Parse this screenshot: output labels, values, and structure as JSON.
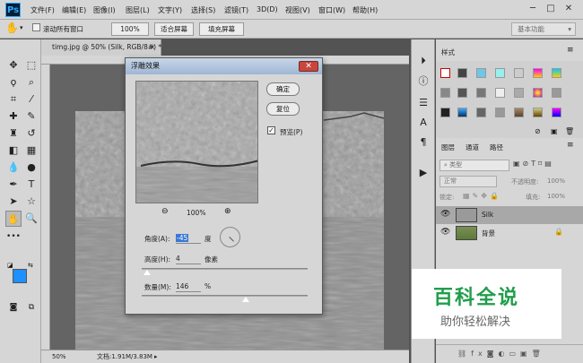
{
  "app": {
    "logo": "Ps"
  },
  "menu": [
    "文件(F)",
    "编辑(E)",
    "图像(I)",
    "图层(L)",
    "文字(Y)",
    "选择(S)",
    "滤镜(T)",
    "3D(D)",
    "视图(V)",
    "窗口(W)",
    "帮助(H)"
  ],
  "window_controls": {
    "minimize": "─",
    "maximize": "□",
    "close": "✕"
  },
  "options": {
    "scroll_all": "滚动所有窗口",
    "zoom": "100%",
    "fit": "适合屏幕",
    "fill": "填充屏幕",
    "workspace": "基本功能"
  },
  "document": {
    "tab": "timg.jpg @ 50% (Silk, RGB/8#) *",
    "tab_close": "×",
    "zoom": "50%",
    "doc_info": "文档:1.91M/3.83M"
  },
  "dialog": {
    "title": "浮雕效果",
    "ok": "确定",
    "reset": "复位",
    "preview": "预览(P)",
    "preview_zoom": "100%",
    "angle_label": "角度(A):",
    "angle_value": "-45",
    "angle_unit": "度",
    "height_label": "高度(H):",
    "height_value": "4",
    "height_unit": "像素",
    "amount_label": "数量(M):",
    "amount_value": "146",
    "amount_unit": "%",
    "height_fraction": 0.03,
    "amount_fraction": 0.3
  },
  "styles_panel": {
    "tab": "样式"
  },
  "layers_panel": {
    "tabs": [
      "图层",
      "通道",
      "路径"
    ],
    "kind": "类型",
    "blend": "正常",
    "opacity_label": "不透明度:",
    "opacity": "100%",
    "lock_label": "锁定:",
    "fill_label": "填充:",
    "fill": "100%",
    "layers": [
      {
        "name": "Silk",
        "selected": true
      },
      {
        "name": "背景",
        "selected": false
      }
    ]
  },
  "watermark": {
    "title": "百科全说",
    "subtitle": "助你轻松解决"
  },
  "colors": {
    "foreground": "#1e90ff",
    "background": "#ffffff",
    "watermark_green": "#1f9e4a"
  }
}
